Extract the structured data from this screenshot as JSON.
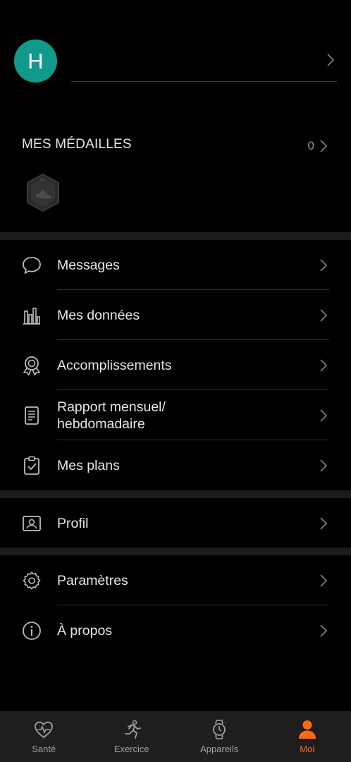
{
  "profile": {
    "avatar_letter": "H",
    "name": ""
  },
  "medals": {
    "title": "MES MÉDAILLES",
    "count": "0",
    "badge_icon": "shoe-medal-icon"
  },
  "menu_group1": [
    {
      "label": "Messages",
      "icon": "chat-bubble-icon"
    },
    {
      "label": "Mes données",
      "icon": "bar-chart-icon"
    },
    {
      "label": "Accomplissements",
      "icon": "award-ribbon-icon"
    },
    {
      "label": "Rapport mensuel/\nhebdomadaire",
      "icon": "report-document-icon"
    },
    {
      "label": "Mes plans",
      "icon": "clipboard-check-icon"
    }
  ],
  "menu_group2": [
    {
      "label": "Profil",
      "icon": "profile-card-icon"
    }
  ],
  "menu_group3": [
    {
      "label": "Paramètres",
      "icon": "gear-icon"
    },
    {
      "label": "À propos",
      "icon": "info-icon"
    }
  ],
  "tabbar": {
    "tabs": [
      {
        "label": "Santé",
        "icon": "heart-pulse-icon",
        "active": false
      },
      {
        "label": "Exercice",
        "icon": "runner-icon",
        "active": false
      },
      {
        "label": "Appareils",
        "icon": "watch-icon",
        "active": false
      },
      {
        "label": "Moi",
        "icon": "person-icon",
        "active": true
      }
    ]
  },
  "colors": {
    "accent": "#ff6a1a",
    "avatar_bg": "#0f9a8b",
    "background": "#000000",
    "tabbar_bg": "#1e1e1e"
  }
}
